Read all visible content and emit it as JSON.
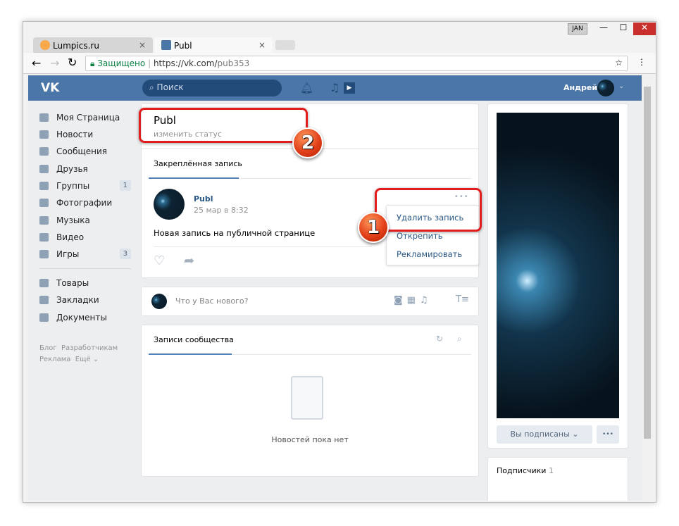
{
  "window": {
    "user_badge": "JAN",
    "minimize": "—",
    "maximize": "☐",
    "close": "✕"
  },
  "tabs": [
    {
      "label": "Lumpics.ru",
      "close": "×"
    },
    {
      "label": "Publ",
      "close": "×"
    }
  ],
  "address": {
    "secure_label": "Защищено",
    "url_host": "https://vk.com/",
    "url_path": "pub353"
  },
  "vk_header": {
    "logo": "VK",
    "search_placeholder": "Поиск",
    "user_name": "Андрей"
  },
  "sidebar": {
    "items": [
      {
        "label": "Моя Страница",
        "icon": "home-icon"
      },
      {
        "label": "Новости",
        "icon": "news-icon"
      },
      {
        "label": "Сообщения",
        "icon": "messages-icon"
      },
      {
        "label": "Друзья",
        "icon": "friends-icon"
      },
      {
        "label": "Группы",
        "icon": "groups-icon",
        "badge": "1"
      },
      {
        "label": "Фотографии",
        "icon": "photos-icon"
      },
      {
        "label": "Музыка",
        "icon": "music-icon"
      },
      {
        "label": "Видео",
        "icon": "video-icon"
      },
      {
        "label": "Игры",
        "icon": "games-icon",
        "badge": "3"
      },
      {
        "label": "Товары",
        "icon": "goods-icon"
      },
      {
        "label": "Закладки",
        "icon": "bookmarks-icon"
      },
      {
        "label": "Документы",
        "icon": "documents-icon"
      }
    ],
    "footer": [
      "Блог",
      "Разработчикам",
      "Реклама",
      "Ещё ⌄"
    ]
  },
  "page": {
    "title": "Publ",
    "status": "изменить статус"
  },
  "pinned": {
    "tab": "Закреплённая запись",
    "author": "Publ",
    "date": "25 мар в 8:32",
    "text": "Новая запись на публичной странице",
    "menu": [
      "Удалить запись",
      "Открепить",
      "Рекламировать"
    ]
  },
  "composer": {
    "placeholder": "Что у Вас нового?"
  },
  "wall": {
    "tab": "Записи сообщества",
    "empty": "Новостей пока нет"
  },
  "right": {
    "subscribed": "Вы подписаны ⌄",
    "more": "•••",
    "subscribers_label": "Подписчики",
    "subscribers_count": "1"
  },
  "annotations": [
    "1",
    "2"
  ]
}
